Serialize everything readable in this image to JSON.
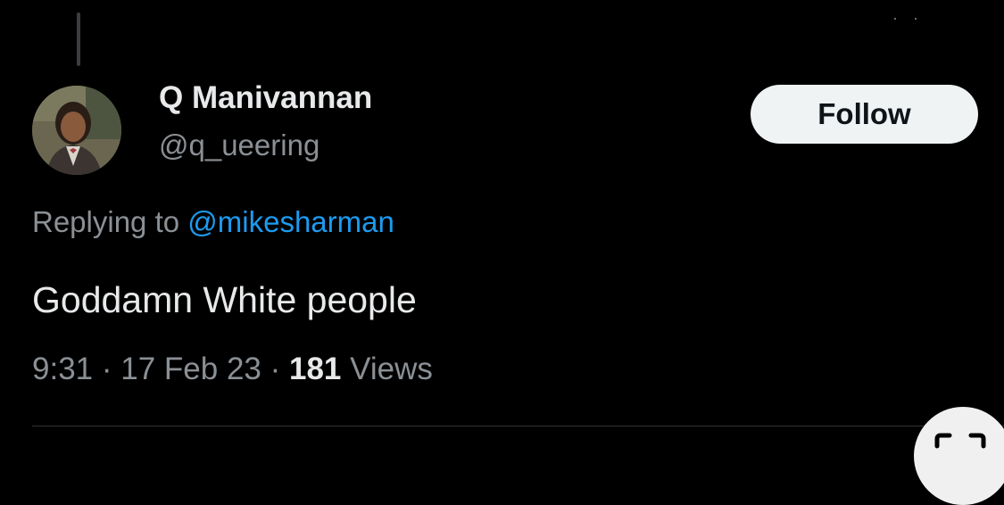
{
  "tweet": {
    "author": {
      "display_name": "Q Manivannan",
      "handle": "@q_ueering",
      "avatar_icon": "user-avatar"
    },
    "follow_label": "Follow",
    "replying_prefix": "Replying to",
    "replying_to": "@mikesharman",
    "text": "Goddamn White people",
    "time": "9:31",
    "date": "17 Feb 23",
    "views_count": "181",
    "views_label": "Views",
    "separator": "·"
  },
  "colors": {
    "background": "#000000",
    "primary_text": "#e7e9ea",
    "secondary_text": "#8b9095",
    "link": "#1d9bf0",
    "follow_bg": "#eff3f4",
    "follow_text": "#0f1419"
  },
  "overlay": {
    "corner_icon": "scan-icon",
    "top_icon": "more-dots-icon"
  }
}
